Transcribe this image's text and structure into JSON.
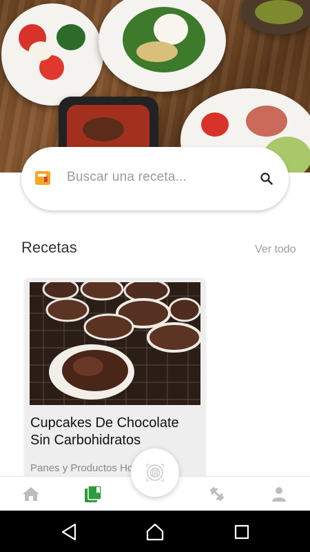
{
  "search": {
    "placeholder": "Buscar una receta..."
  },
  "recipes_section": {
    "title": "Recetas",
    "see_all_label": "Ver todo",
    "items": [
      {
        "title": "Cupcakes De Chocolate Sin Carbohidratos",
        "category": "Panes y Productos Ho"
      }
    ]
  },
  "nav": {
    "items": [
      "home-icon",
      "recipes-icon",
      "scan-icon",
      "fitness-icon",
      "profile-icon"
    ],
    "active_index": 1
  },
  "colors": {
    "accent": "#2e9b3e",
    "inactive_icon": "#bdbdbd",
    "book_icon": "#f5a623"
  },
  "system_bar": {
    "buttons": [
      "back-icon",
      "home-system-icon",
      "recents-icon"
    ]
  }
}
